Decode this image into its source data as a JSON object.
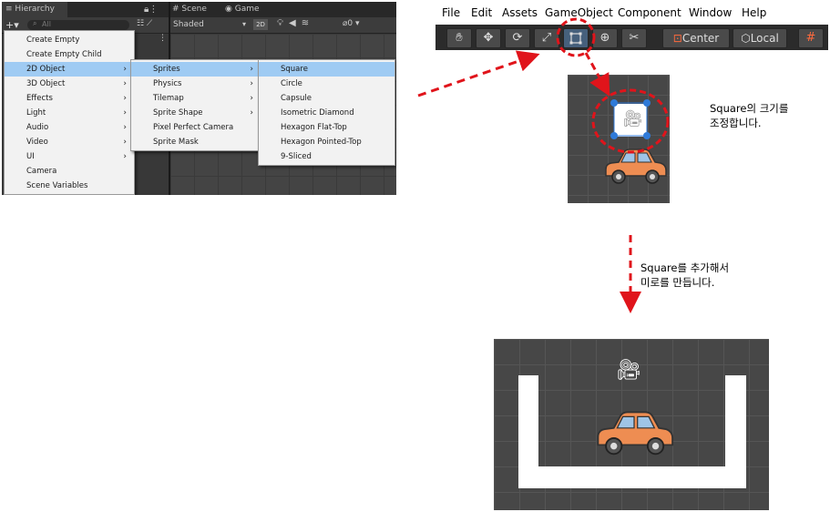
{
  "editor": {
    "tabs": {
      "hierarchy": "Hierarchy",
      "scene": "Scene",
      "game": "Game"
    },
    "toolbar": {
      "add": "+▾",
      "search_placeholder": "All",
      "shading": "Shaded",
      "mode_2d": "2D",
      "gizmo_count": "0"
    },
    "create_menu": [
      {
        "label": "Create Empty",
        "submenu": false
      },
      {
        "label": "Create Empty Child",
        "submenu": false
      },
      {
        "label": "2D Object",
        "submenu": true,
        "selected": true
      },
      {
        "label": "3D Object",
        "submenu": true
      },
      {
        "label": "Effects",
        "submenu": true
      },
      {
        "label": "Light",
        "submenu": true
      },
      {
        "label": "Audio",
        "submenu": true
      },
      {
        "label": "Video",
        "submenu": true
      },
      {
        "label": "UI",
        "submenu": true
      },
      {
        "label": "Camera",
        "submenu": false
      },
      {
        "label": "Scene Variables",
        "submenu": false
      }
    ],
    "object2d_menu": [
      {
        "label": "Sprites",
        "submenu": true,
        "selected": true
      },
      {
        "label": "Physics",
        "submenu": true
      },
      {
        "label": "Tilemap",
        "submenu": true
      },
      {
        "label": "Sprite Shape",
        "submenu": true
      },
      {
        "label": "Pixel Perfect Camera",
        "submenu": false
      },
      {
        "label": "Sprite Mask",
        "submenu": false
      }
    ],
    "sprites_menu": [
      {
        "label": "Square",
        "selected": true
      },
      {
        "label": "Circle"
      },
      {
        "label": "Capsule"
      },
      {
        "label": "Isometric Diamond"
      },
      {
        "label": "Hexagon Flat-Top"
      },
      {
        "label": "Hexagon Pointed-Top"
      },
      {
        "label": "9-Sliced"
      }
    ]
  },
  "menubar": {
    "items": [
      "File",
      "Edit",
      "Assets",
      "GameObject",
      "Component",
      "Window",
      "Help"
    ],
    "tools": [
      "hand-tool-icon",
      "move-tool-icon",
      "rotate-tool-icon",
      "scale-tool-icon",
      "rect-tool-icon",
      "transform-tool-icon",
      "custom-tool-icon"
    ],
    "pivot_label": "Center",
    "space_label": "Local"
  },
  "notes": {
    "resize": "Square의 크기를\n조정합니다.",
    "add_maze": "Square를 추가해서\n미로를 만듭니다."
  },
  "colors": {
    "highlight": "#9fcbf3",
    "arrow_red": "#e0141b",
    "car_orange": "#ee8d52",
    "editor_dark": "#383838"
  }
}
